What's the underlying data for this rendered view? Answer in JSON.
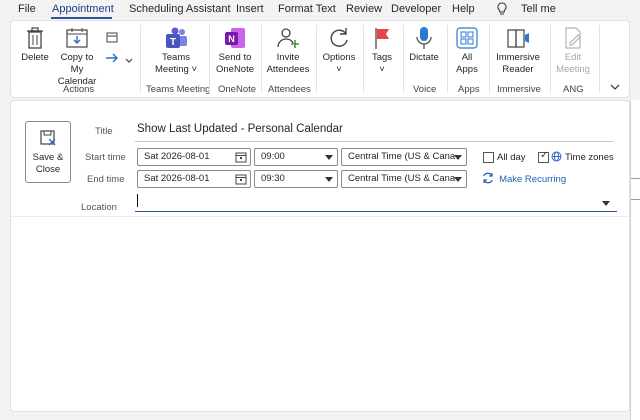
{
  "menu": {
    "tabs": [
      "File",
      "Appointment",
      "Scheduling Assistant",
      "Insert",
      "Format Text",
      "Review",
      "Developer",
      "Help"
    ],
    "active_tab": "Appointment",
    "tell_me": "Tell me"
  },
  "ribbon": {
    "delete_label": "Delete",
    "copy_label_1": "Copy to My",
    "copy_label_2": "Calendar",
    "actions_group": "Actions",
    "teams_label_1": "Teams",
    "teams_label_2": "Meeting",
    "teams_group": "Teams Meeting",
    "onenote_label_1": "Send to",
    "onenote_label_2": "OneNote",
    "onenote_group": "OneNote",
    "invite_label_1": "Invite",
    "invite_label_2": "Attendees",
    "attendees_group": "Attendees",
    "options_label": "Options",
    "tags_label": "Tags",
    "dictate_label": "Dictate",
    "voice_group": "Voice",
    "allapps_label_1": "All",
    "allapps_label_2": "Apps",
    "apps_group": "Apps",
    "reader_label_1": "Immersive",
    "reader_label_2": "Reader",
    "immersive_group": "Immersive",
    "editmeeting_label_1": "Edit",
    "editmeeting_label_2": "Meeting",
    "ang_group": "ANG"
  },
  "form": {
    "save_close_1": "Save &",
    "save_close_2": "Close",
    "title_label": "Title",
    "title_value": "Show Last Updated - Personal Calendar",
    "start_label": "Start time",
    "start_date": "Sat 2026-08-01",
    "start_time": "09:00",
    "start_tz": "Central Time (US & Cana",
    "end_label": "End time",
    "end_date": "Sat 2026-08-01",
    "end_time": "09:30",
    "end_tz": "Central Time (US & Cana",
    "all_day_label": "All day",
    "all_day_checked": false,
    "time_zones_label": "Time zones",
    "time_zones_checked": true,
    "make_recurring_label": "Make Recurring",
    "location_label": "Location",
    "location_value": ""
  },
  "colors": {
    "accent": "#2b579a",
    "link": "#1f5fb0",
    "teams": "#5b5fc7",
    "onenote": "#7719aa"
  }
}
